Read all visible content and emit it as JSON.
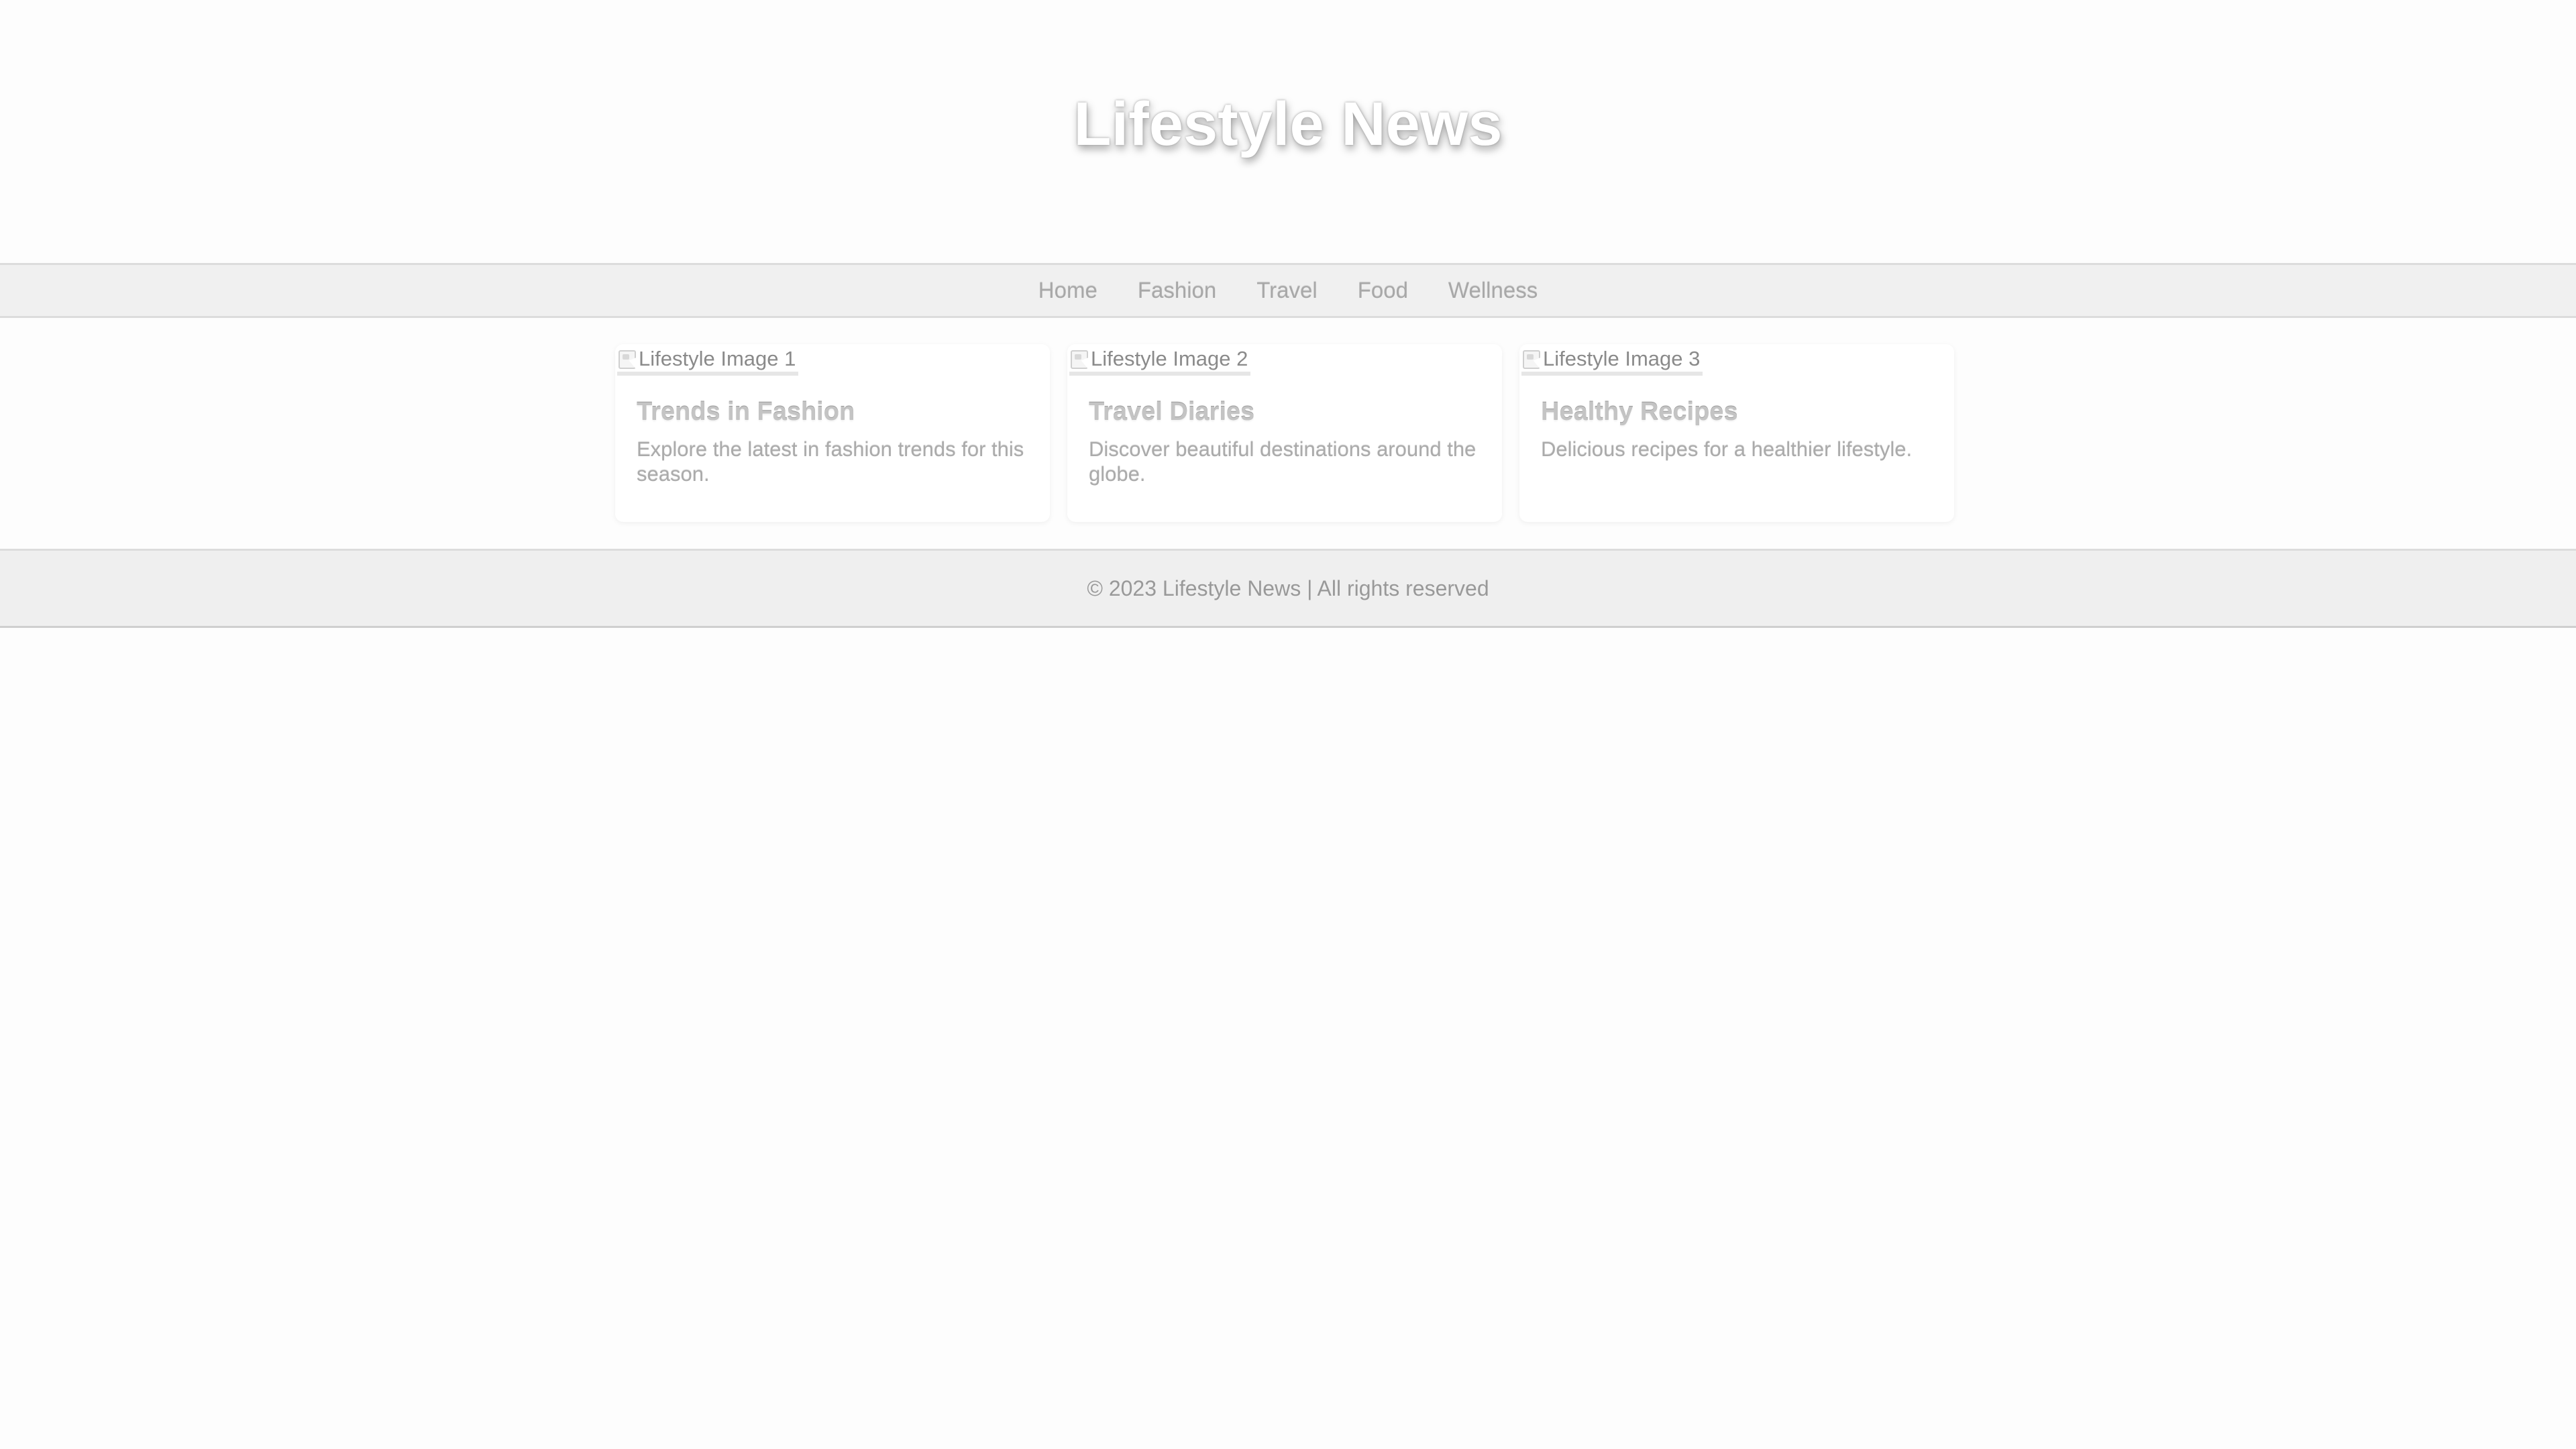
{
  "header": {
    "title": "Lifestyle News"
  },
  "nav": {
    "items": [
      {
        "label": "Home"
      },
      {
        "label": "Fashion"
      },
      {
        "label": "Travel"
      },
      {
        "label": "Food"
      },
      {
        "label": "Wellness"
      }
    ]
  },
  "articles": [
    {
      "image_alt": "Lifestyle Image 1",
      "title": "Trends in Fashion",
      "description": "Explore the latest in fashion trends for this season."
    },
    {
      "image_alt": "Lifestyle Image 2",
      "title": "Travel Diaries",
      "description": "Discover beautiful destinations around the globe."
    },
    {
      "image_alt": "Lifestyle Image 3",
      "title": "Healthy Recipes",
      "description": "Delicious recipes for a healthier lifestyle."
    }
  ],
  "footer": {
    "text": "© 2023 Lifestyle News | All rights reserved"
  },
  "colors": {
    "background": "#fdfdfd",
    "bar_background": "#f0f0f0",
    "title_text": "#ffffff",
    "muted_text": "#9a9a9a"
  },
  "icons": {
    "broken_image": "broken-image-icon"
  }
}
